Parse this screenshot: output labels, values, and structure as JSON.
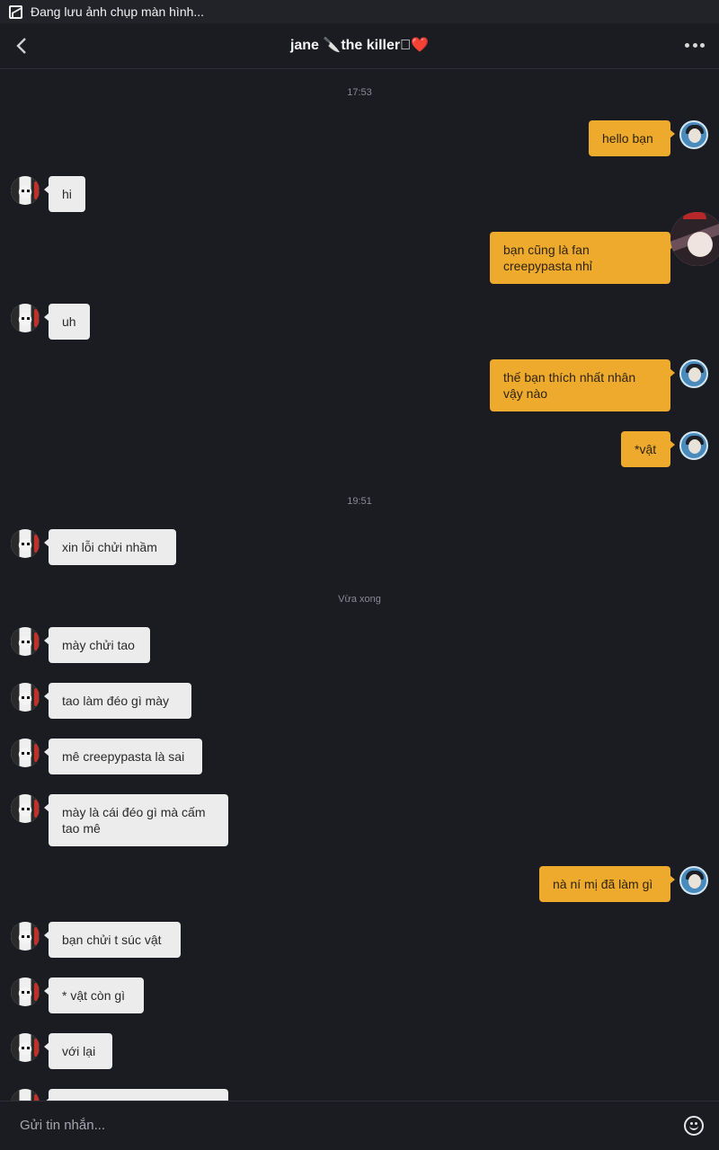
{
  "status_bar": {
    "notification": "Đang lưu ảnh chụp màn hình..."
  },
  "header": {
    "title": "jane 🔪the killer🏿❤️"
  },
  "timestamps": [
    "17:53",
    "19:51",
    "Vừa xong"
  ],
  "messages": [
    {
      "side": "out",
      "text": "hello bạn"
    },
    {
      "side": "in",
      "text": "hi"
    },
    {
      "side": "out",
      "text": "bạn cũng là fan creepypasta nhỉ"
    },
    {
      "side": "in",
      "text": "uh"
    },
    {
      "side": "out",
      "text": "thế bạn thích nhất nhân vậy nào"
    },
    {
      "side": "out",
      "text": "*vật"
    },
    {
      "side": "in",
      "text": "xin lỗi chửi nhầm"
    },
    {
      "side": "in",
      "text": "mày chửi tao"
    },
    {
      "side": "in",
      "text": "tao làm đéo gì mày"
    },
    {
      "side": "in",
      "text": "mê creepypasta là sai"
    },
    {
      "side": "in",
      "text": "mày là cái đéo gì mà cấm tao mê"
    },
    {
      "side": "out",
      "text": "nà ní mị đã làm gì"
    },
    {
      "side": "in",
      "text": "bạn chửi t súc vật"
    },
    {
      "side": "in",
      "text": "* vật còn gì"
    },
    {
      "side": "in",
      "text": "với lại"
    },
    {
      "side": "in",
      "text": ""
    }
  ],
  "composer": {
    "placeholder": "Gửi tin nhắn..."
  },
  "colors": {
    "background": "#1b1c22",
    "outgoing_bubble": "#eeaa2c",
    "incoming_bubble": "#ececec"
  }
}
